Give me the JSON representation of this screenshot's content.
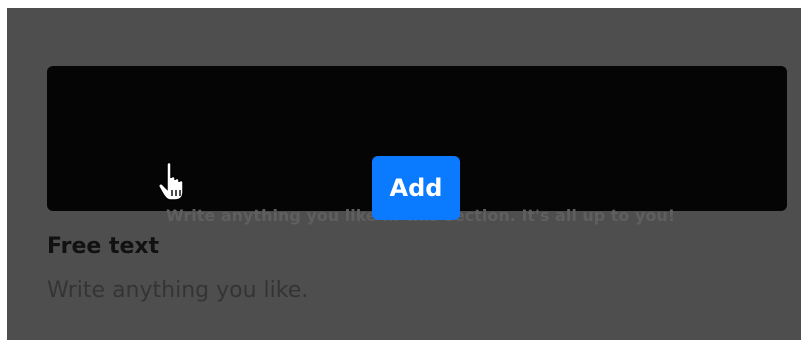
{
  "block": {
    "preview_text": "Write anything you like in this section. It's all up to you!",
    "add_label": "Add",
    "title": "Free text",
    "description": "Write anything you like."
  },
  "colors": {
    "overlay": "#4e4e4e",
    "card": "#050505",
    "accent": "#0a7bff"
  },
  "icons": {
    "cursor": "hand-pointer-icon"
  }
}
